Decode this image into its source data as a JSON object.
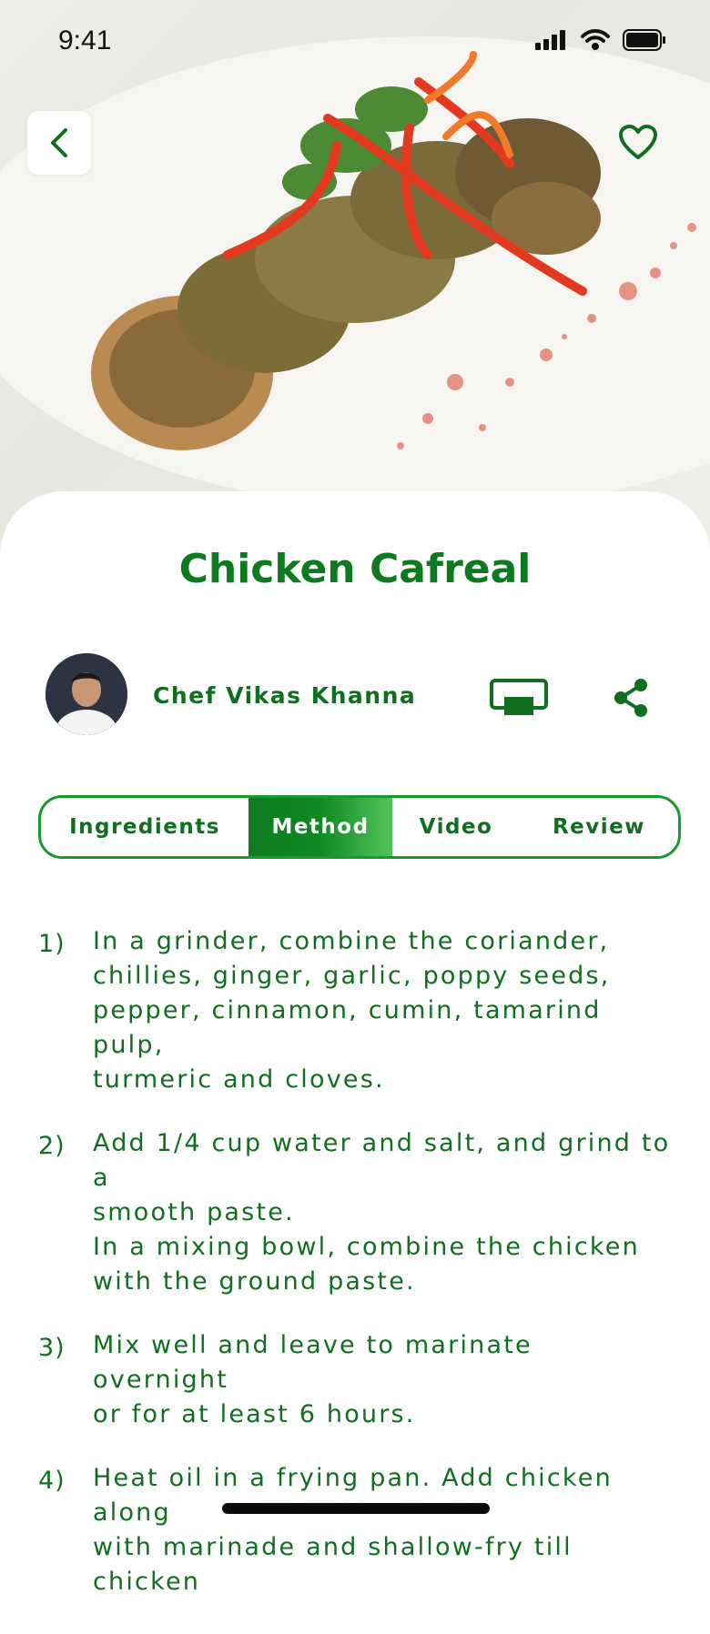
{
  "status_bar": {
    "time": "9:41"
  },
  "recipe": {
    "title": "Chicken Cafreal"
  },
  "chef": {
    "name": "Chef Vikas Khanna"
  },
  "tabs": [
    {
      "label": "Ingredients",
      "active": false
    },
    {
      "label": "Method",
      "active": true
    },
    {
      "label": "Video",
      "active": false
    },
    {
      "label": "Review",
      "active": false
    }
  ],
  "steps": [
    {
      "number": "1)",
      "text": "In a grinder, combine the coriander,\nchillies, ginger, garlic, poppy seeds,\npepper, cinnamon, cumin, tamarind pulp,\nturmeric and cloves."
    },
    {
      "number": "2)",
      "text": "Add 1/4 cup water and salt, and grind to a\nsmooth paste.\nIn a mixing bowl, combine the chicken\nwith the ground paste."
    },
    {
      "number": "3)",
      "text": "Mix well and leave to marinate overnight\nor for at least 6 hours."
    },
    {
      "number": "4)",
      "text": "Heat oil in a frying pan. Add chicken along\nwith marinade and shallow-fry till chicken"
    }
  ],
  "icons": {
    "back": "chevron-left-icon",
    "favorite": "heart-icon",
    "cast": "cast-screen-icon",
    "share": "share-icon"
  },
  "colors": {
    "accent": "#106f1f",
    "tab_active_start": "#0f7a1f",
    "tab_active_end": "#54c45a"
  }
}
